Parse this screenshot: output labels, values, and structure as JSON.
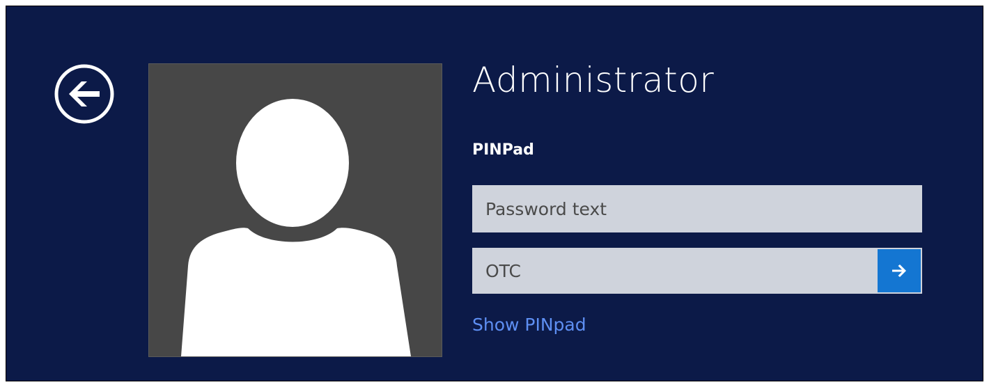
{
  "account": {
    "username": "Administrator",
    "credential_provider": "PINPad"
  },
  "password_field": {
    "placeholder": "Password text",
    "value": ""
  },
  "otc_field": {
    "placeholder": "OTC",
    "value": ""
  },
  "links": {
    "show_pinpad": "Show PINpad"
  },
  "icons": {
    "back": "back-arrow-circle-icon",
    "submit": "arrow-right-icon",
    "avatar": "user-silhouette-icon"
  },
  "colors": {
    "background": "#0c1a48",
    "submit_button": "#1476d2",
    "link": "#5e8ff3",
    "field": "#cfd3dc",
    "avatar_tile": "#474747"
  }
}
